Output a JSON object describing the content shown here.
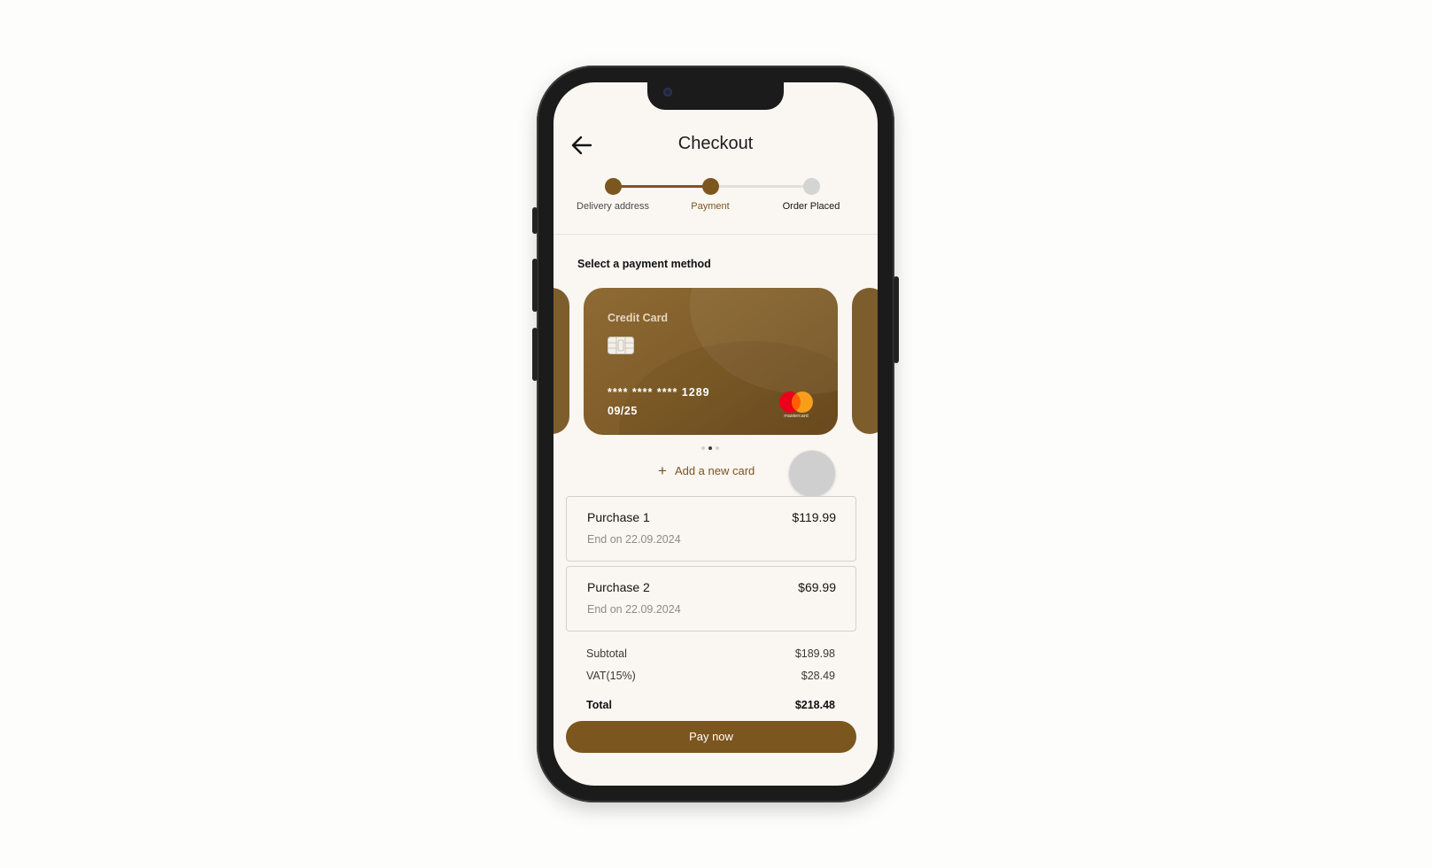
{
  "header": {
    "title": "Checkout"
  },
  "stepper": {
    "steps": [
      {
        "label": "Delivery address",
        "state": "done"
      },
      {
        "label": "Payment",
        "state": "current"
      },
      {
        "label": "Order Placed",
        "state": "pending"
      }
    ]
  },
  "payment": {
    "section_title": "Select a payment method",
    "card": {
      "type_label": "Credit Card",
      "number": "**** **** **** 1289",
      "expiry": "09/25",
      "brand": "mastercard"
    },
    "carousel": {
      "count": 3,
      "active_index": 1
    },
    "add_card_label": "Add a new card"
  },
  "purchases": [
    {
      "name": "Purchase 1",
      "price": "$119.99",
      "end": "End on 22.09.2024"
    },
    {
      "name": "Purchase 2",
      "price": "$69.99",
      "end": "End on 22.09.2024"
    }
  ],
  "summary": {
    "subtotal_label": "Subtotal",
    "subtotal_value": "$189.98",
    "vat_label": "VAT(15%)",
    "vat_value": "$28.49",
    "total_label": "Total",
    "total_value": "$218.48"
  },
  "actions": {
    "pay_label": "Pay now"
  },
  "colors": {
    "accent": "#7c561f",
    "accent_text": "#7a5526",
    "screen_bg": "#faf6f1",
    "inactive": "#d4d4d4"
  },
  "icons": [
    "back-arrow-icon",
    "chip-icon",
    "mastercard-logo",
    "plus-icon"
  ]
}
